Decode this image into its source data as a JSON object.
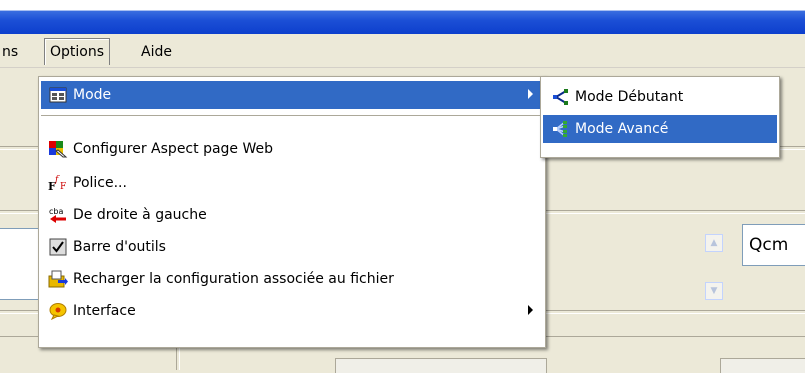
{
  "menubar": {
    "prev_fragment": "ns",
    "options": "Options",
    "aide": "Aide"
  },
  "main_menu": {
    "items": [
      {
        "label": "Mode",
        "icon": "grid-window-icon",
        "has_submenu": true,
        "highlighted": true
      },
      {
        "label": "Configurer Aspect page Web",
        "icon": "palette-page-icon"
      },
      {
        "label": "Police...",
        "icon": "font-icon"
      },
      {
        "label": "De droite à gauche",
        "icon": "rtl-arrow-icon",
        "icon_text": "cba"
      },
      {
        "label": "Barre d'outils",
        "icon": "checkbox-icon"
      },
      {
        "label": "Recharger la configuration associée au fichier",
        "icon": "reload-config-icon"
      },
      {
        "label": "Interface",
        "icon": "speech-bubble-icon",
        "has_submenu": true
      }
    ]
  },
  "sub_menu": {
    "items": [
      {
        "label": "Mode Débutant",
        "icon": "tree-simple-icon"
      },
      {
        "label": "Mode Avancé",
        "icon": "tree-advanced-icon",
        "highlighted": true
      }
    ]
  },
  "background": {
    "qcm_fragment": "Qcm"
  },
  "colors": {
    "highlight": "#316ac5",
    "titlebar": "#0d3fcd",
    "face": "#ece9d8"
  }
}
